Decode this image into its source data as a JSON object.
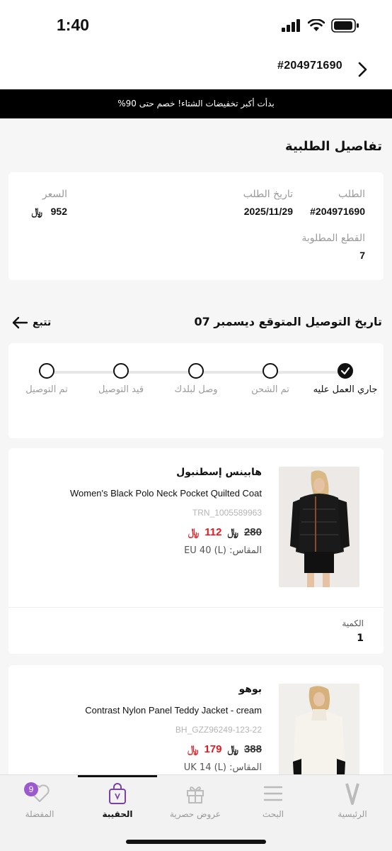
{
  "status_bar": {
    "time": "1:40"
  },
  "header": {
    "order_number": "#204971690",
    "back_icon": "chevron-right-icon"
  },
  "promo_banner": "بدأت أكبر تخفيضات الشتاء! خصم حتى 90%",
  "order_details": {
    "title": "تفاصيل الطلبية",
    "order_label": "الطلب",
    "order_value": "#204971690",
    "date_label": "تاريخ الطلب",
    "date_value": "2025/11/29",
    "price_label": "السعر",
    "price_value": "952",
    "items_label": "القطع المطلوبة",
    "items_value": "7"
  },
  "currency_symbol": "﷼",
  "delivery": {
    "title": "تاريخ التوصيل المتوقع ديسمبر 07",
    "track_label": "تتبع"
  },
  "progress": {
    "steps": [
      {
        "label": "جاري العمل عليه",
        "done": true
      },
      {
        "label": "تم الشحن",
        "done": false
      },
      {
        "label": "وصل لبلدك",
        "done": false
      },
      {
        "label": "قيد التوصيل",
        "done": false
      },
      {
        "label": "تم التوصيل",
        "done": false
      }
    ]
  },
  "products": [
    {
      "brand": "هابينس إسطنبول",
      "name": "Women's Black Polo Neck Pocket Quilted Coat",
      "sku": "TRN_1005589963",
      "old_price": "280",
      "new_price": "112",
      "size": "المقاس: EU 40 (L)",
      "qty_label": "الكمية",
      "qty": "1"
    },
    {
      "brand": "بوهو",
      "name": "Contrast Nylon Panel Teddy Jacket - cream",
      "sku": "BH_GZZ96249-123-22",
      "old_price": "388",
      "new_price": "179",
      "size": "المقاس: UK 14 (L)"
    }
  ],
  "tab_bar": {
    "favorites": "المفضلة",
    "favorites_badge": "9",
    "bag": "الحقيبة",
    "offers": "عروض حصرية",
    "search": "البحث",
    "home": "الرئيسية"
  },
  "colors": {
    "accent_red": "#e11b23",
    "badge_purple": "#9b59d0"
  }
}
